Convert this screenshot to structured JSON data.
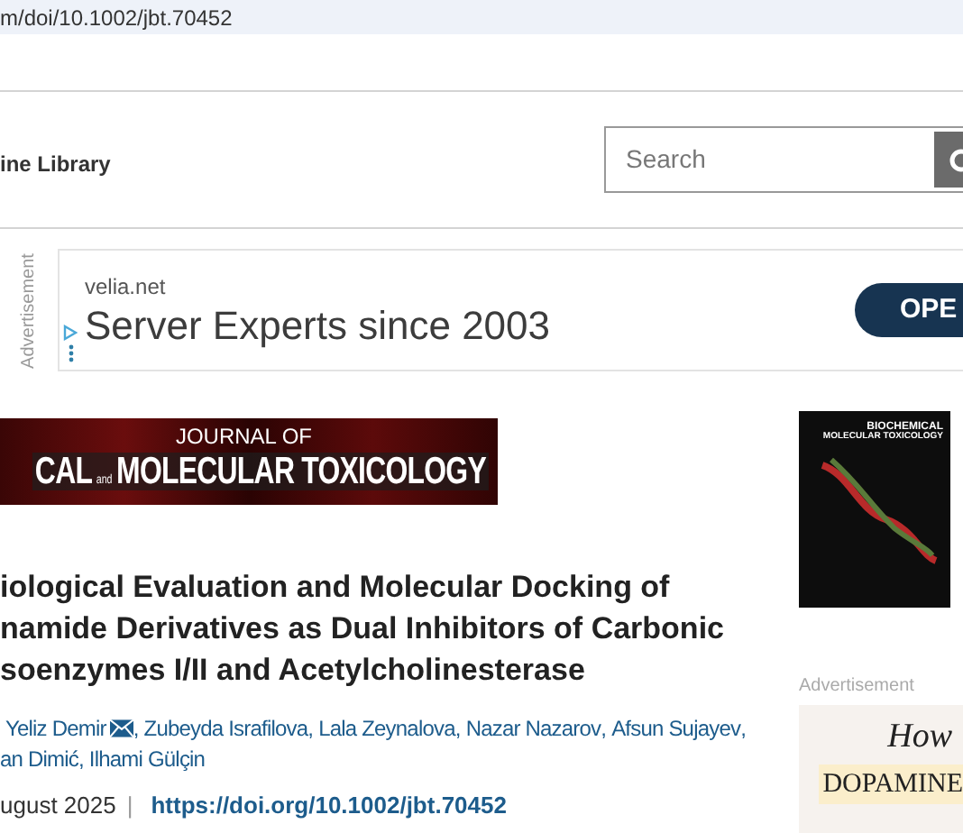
{
  "address_bar": {
    "url": "m/doi/10.1002/jbt.70452"
  },
  "header": {
    "brand": "ine Library",
    "search": {
      "placeholder": "Search"
    }
  },
  "top_ad": {
    "label": "Advertisement",
    "domain": "velia.net",
    "headline": "Server Experts since 2003",
    "button": "OPE"
  },
  "journal_banner": {
    "line_1": "JOURNAL OF",
    "line_2_left": "CAL",
    "line_2_and": "and",
    "line_2_right": "MOLECULAR TOXICOLOGY"
  },
  "cover": {
    "title_1": "BIOCHEMICAL",
    "title_2": "MOLECULAR TOXICOLOGY"
  },
  "article": {
    "title_lines": [
      "iological Evaluation and Molecular Docking of",
      "namide Derivatives as Dual Inhibitors of Carbonic",
      "soenzymes I/II and Acetylcholinesterase"
    ],
    "author_lines": [
      [
        {
          "name": "Yeliz Demir",
          "mail": true,
          "after": ","
        },
        {
          "name": "Zubeyda Israfilova",
          "mail": false,
          "after": ","
        },
        {
          "name": "Lala Zeynalova",
          "mail": false,
          "after": ","
        },
        {
          "name": "Nazar Nazarov",
          "mail": false,
          "after": ","
        },
        {
          "name": "Afsun Sujayev",
          "mail": false,
          "after": ","
        }
      ],
      [
        {
          "name": "an Dimić",
          "mail": false,
          "after": ","
        },
        {
          "name": "Ilhami Gülçin",
          "mail": false
        }
      ]
    ],
    "date": "ugust 2025",
    "separator": "|",
    "doi": "https://doi.org/10.1002/jbt.70452"
  },
  "side_ad": {
    "label": "Advertisement",
    "line_1": "How",
    "line_2": "DOPAMINE"
  }
}
